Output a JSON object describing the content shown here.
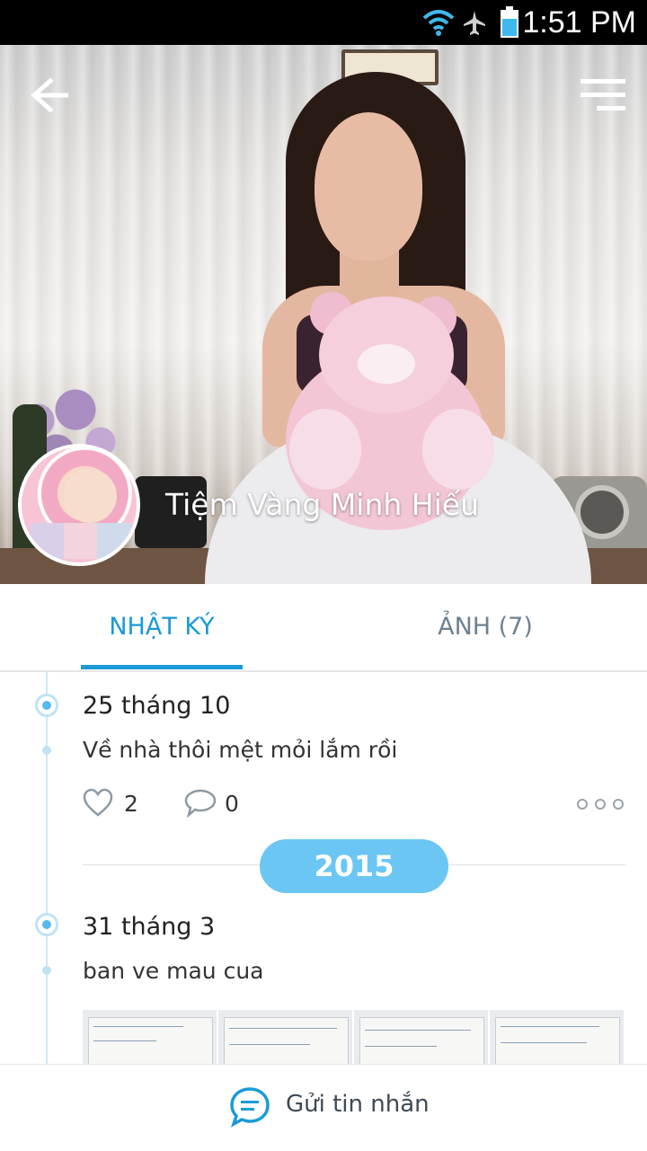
{
  "status_bar": {
    "time": "1:51 PM",
    "icons": [
      "wifi-icon",
      "airplane-icon",
      "battery-icon"
    ]
  },
  "header": {
    "back_icon": "back-arrow-icon",
    "menu_icon": "hamburger-menu-icon",
    "profile_name": "Tiệm Vàng Minh Hiếu"
  },
  "tabs": [
    {
      "label": "NHẬT KÝ",
      "active": true
    },
    {
      "label": "ẢNH (7)",
      "active": false
    }
  ],
  "feed": {
    "posts": [
      {
        "date": "25 tháng 10",
        "text": "Về nhà thôi mệt mỏi lắm rồi",
        "likes": "2",
        "comments": "0"
      },
      {
        "date": "31 tháng 3",
        "text": "ban ve mau cua"
      }
    ],
    "year_marker": "2015"
  },
  "bottom_bar": {
    "send_label": "Gửi tin nhắn"
  },
  "colors": {
    "accent": "#1a9ad6",
    "year_pill": "#6bc6f4",
    "timeline": "#bfe3f5"
  }
}
